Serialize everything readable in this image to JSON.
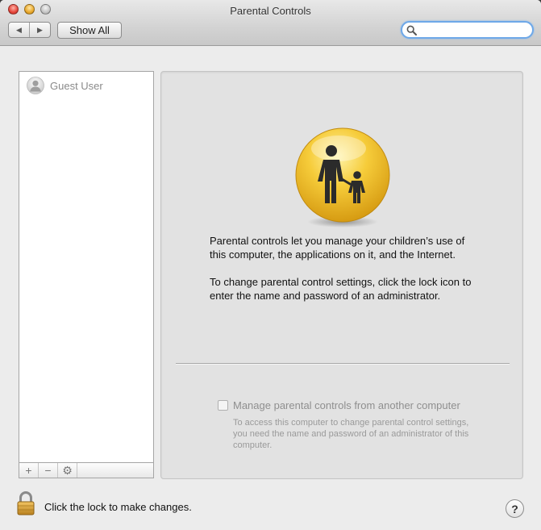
{
  "window": {
    "title": "Parental Controls"
  },
  "toolbar": {
    "back_glyph": "◀",
    "forward_glyph": "▶",
    "show_all_label": "Show All",
    "search": {
      "value": "",
      "placeholder": ""
    }
  },
  "sidebar": {
    "users": [
      {
        "name": "Guest User",
        "icon": "user-silhouette-icon"
      }
    ],
    "add_glyph": "+",
    "remove_glyph": "−",
    "action_glyph": "⚙"
  },
  "main": {
    "icon": "parent-child-icon",
    "paragraph1": "Parental controls let you manage your children’s use of this computer, the applications on it, and the Internet.",
    "paragraph2": "To change parental control settings, click the lock icon to enter the name and password of an administrator.",
    "remote_checkbox_label": "Manage parental controls from another computer",
    "remote_checkbox_checked": false,
    "remote_note": "To access this computer to change parental control settings, you need the name and password of an administrator of this computer."
  },
  "footer": {
    "lock_text": "Click the lock to make changes.",
    "help_glyph": "?"
  },
  "colors": {
    "accent_icon": "#f2c12e",
    "search_focus": "#6ea8e8"
  }
}
